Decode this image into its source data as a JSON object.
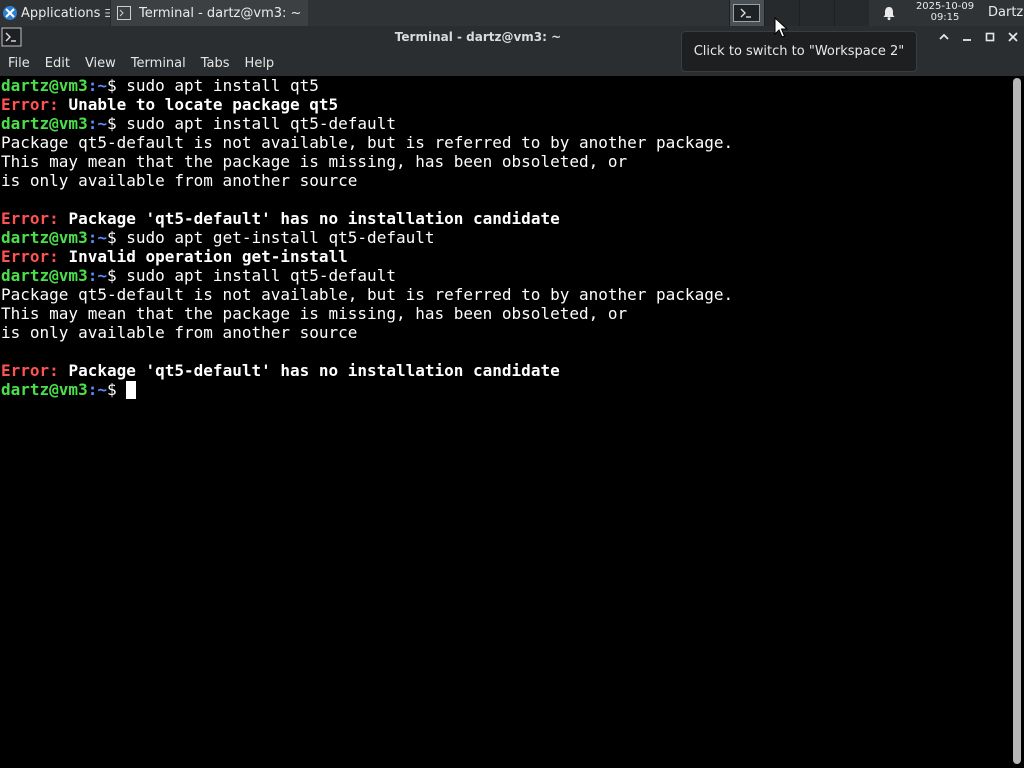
{
  "panel": {
    "apps_label": "Applications",
    "apps_menu_glyph": "☰",
    "task_label": "Terminal - dartz@vm3: ~",
    "clock_date": "2025-10-09",
    "clock_time": "09:15",
    "user": "Dartz"
  },
  "window": {
    "title": "Terminal - dartz@vm3: ~",
    "menu": [
      "File",
      "Edit",
      "View",
      "Terminal",
      "Tabs",
      "Help"
    ]
  },
  "tooltip": "Click to switch to \"Workspace 2\"",
  "terminal": {
    "user_host": "dartz@vm3",
    "path": ":~",
    "prompt_suffix": "$ ",
    "error_prefix": "Error: ",
    "lines": [
      {
        "type": "prompt",
        "cmd": "sudo apt install qt5"
      },
      {
        "type": "error",
        "text": "Unable to locate package qt5"
      },
      {
        "type": "prompt",
        "cmd": "sudo apt install qt5-default"
      },
      {
        "type": "text",
        "text": "Package qt5-default is not available, but is referred to by another package."
      },
      {
        "type": "text",
        "text": "This may mean that the package is missing, has been obsoleted, or"
      },
      {
        "type": "text",
        "text": "is only available from another source"
      },
      {
        "type": "text",
        "text": ""
      },
      {
        "type": "error",
        "text": "Package 'qt5-default' has no installation candidate"
      },
      {
        "type": "prompt",
        "cmd": "sudo apt get-install qt5-default"
      },
      {
        "type": "error",
        "text": "Invalid operation get-install"
      },
      {
        "type": "prompt",
        "cmd": "sudo apt install qt5-default"
      },
      {
        "type": "text",
        "text": "Package qt5-default is not available, but is referred to by another package."
      },
      {
        "type": "text",
        "text": "This may mean that the package is missing, has been obsoleted, or"
      },
      {
        "type": "text",
        "text": "is only available from another source"
      },
      {
        "type": "text",
        "text": ""
      },
      {
        "type": "error",
        "text": "Package 'qt5-default' has no installation candidate"
      },
      {
        "type": "prompt",
        "cmd": "",
        "cursor": true
      }
    ]
  },
  "colors": {
    "prompt_user": "#4ae04a",
    "prompt_path": "#5b8cff",
    "error": "#ff5252",
    "panel_bg": "#2f3336"
  },
  "icons": {
    "apps": "xfce-logo-icon",
    "task": "terminal-icon",
    "workspace": "workspace-icon",
    "notifications": "bell-icon",
    "window": "terminal-icon",
    "min": "minimize-icon",
    "max": "maximize-icon",
    "close": "close-icon",
    "shade": "chevron-up-icon"
  }
}
